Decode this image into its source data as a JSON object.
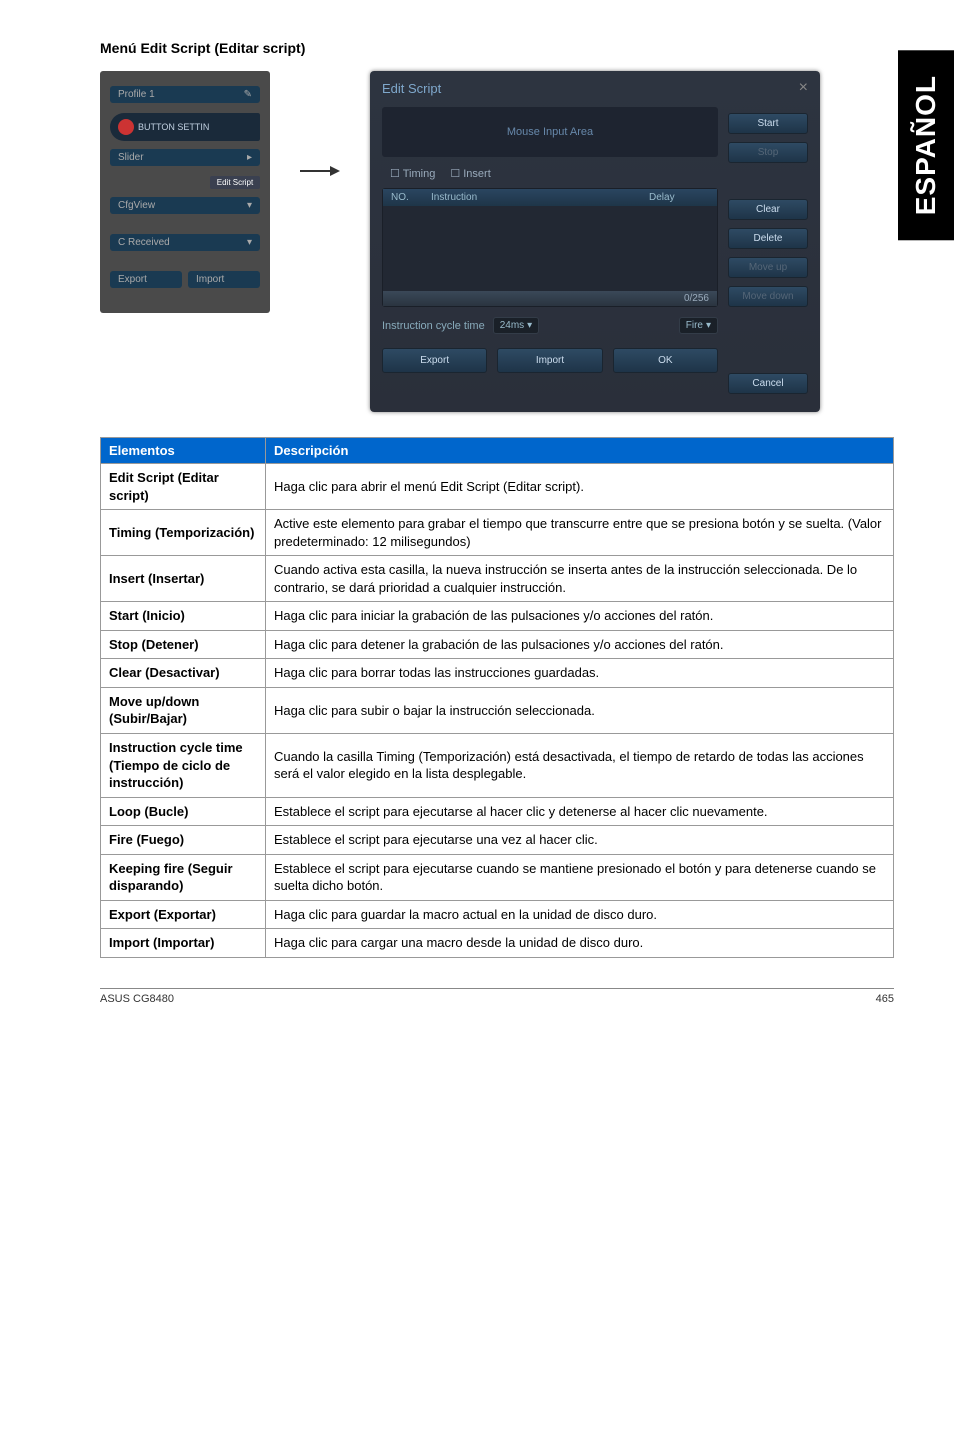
{
  "sideTab": "ESPAÑOL",
  "sectionTitle": "Menú Edit Script (Editar script)",
  "leftPanel": {
    "profile": "Profile 1",
    "brand": "BUTTON SETTIN",
    "slider": "Slider",
    "editScript": "Edit Script",
    "cfgView": "CfgView",
    "cReceived": "C Received",
    "export": "Export",
    "import": "Import"
  },
  "dialog": {
    "title": "Edit Script",
    "inputArea": "Mouse Input Area",
    "tabTiming": "Timing",
    "tabInsert": "Insert",
    "colNo": "NO.",
    "colInstruction": "Instruction",
    "colDelay": "Delay",
    "count": "0/256",
    "start": "Start",
    "stop": "Stop",
    "clear": "Clear",
    "delete": "Delete",
    "moveUp": "Move up",
    "moveDown": "Move down",
    "cycleLabel": "Instruction cycle time",
    "cycleValue": "24ms",
    "fire": "Fire",
    "exportBtn": "Export",
    "importBtn": "Import",
    "ok": "OK",
    "cancel": "Cancel"
  },
  "table": {
    "headElement": "Elementos",
    "headDesc": "Descripción",
    "rows": [
      {
        "label": "Edit Script (Editar script)",
        "desc": "Haga clic para abrir el menú Edit Script (Editar script)."
      },
      {
        "label": "Timing (Temporización)",
        "desc": "Active este elemento para grabar el tiempo que transcurre entre que se presiona botón y se suelta. (Valor predeterminado: 12 milisegundos)"
      },
      {
        "label": "Insert (Insertar)",
        "desc": "Cuando activa esta casilla, la nueva instrucción se inserta antes de la instrucción seleccionada. De lo contrario, se dará prioridad a cualquier instrucción."
      },
      {
        "label": "Start (Inicio)",
        "desc": "Haga clic para iniciar la grabación de las pulsaciones y/o acciones del ratón."
      },
      {
        "label": "Stop (Detener)",
        "desc": "Haga clic para detener la grabación de las pulsaciones y/o acciones del ratón."
      },
      {
        "label": "Clear (Desactivar)",
        "desc": "Haga clic para borrar todas las instrucciones guardadas."
      },
      {
        "label": "Move up/down (Subir/Bajar)",
        "desc": "Haga clic para subir o bajar la instrucción seleccionada."
      },
      {
        "label": "Instruction cycle time (Tiempo de ciclo de instrucción)",
        "desc": "Cuando la casilla Timing (Temporización) está desactivada, el tiempo de retardo de todas las acciones será el valor elegido en la lista desplegable."
      },
      {
        "label": "Loop (Bucle)",
        "desc": "Establece el script para ejecutarse al hacer clic y detenerse al hacer clic nuevamente."
      },
      {
        "label": "Fire (Fuego)",
        "desc": "Establece el script para ejecutarse una vez al hacer clic."
      },
      {
        "label": "Keeping fire (Seguir disparando)",
        "desc": "Establece el script para ejecutarse cuando se mantiene presionado el botón y para detenerse cuando se suelta dicho botón."
      },
      {
        "label": "Export (Exportar)",
        "desc": "Haga clic para guardar la macro actual en la unidad de disco duro."
      },
      {
        "label": "Import (Importar)",
        "desc": "Haga clic para cargar una macro desde la unidad de disco duro."
      }
    ]
  },
  "footer": {
    "left": "ASUS CG8480",
    "right": "465"
  }
}
